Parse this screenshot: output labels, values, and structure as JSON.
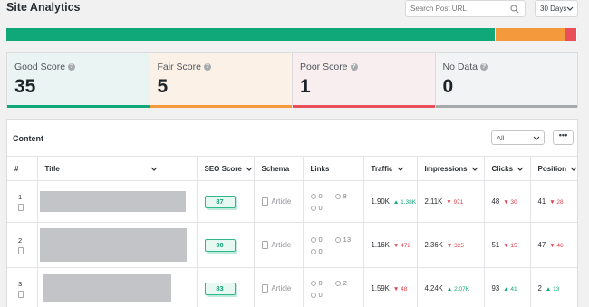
{
  "header": {
    "title": "Site Analytics",
    "search_placeholder": "Search Post URL",
    "range": "30 Days"
  },
  "score_bar": {
    "segments": [
      {
        "name": "good",
        "fraction": 0.8571,
        "color": "#10a779"
      },
      {
        "name": "fair",
        "fraction": 0.1224,
        "color": "#f59a3c"
      },
      {
        "name": "poor",
        "fraction": 0.0204,
        "color": "#e94f5b"
      }
    ]
  },
  "cards": [
    {
      "label": "Good Score",
      "value": "35",
      "bg": "#eaf4f2",
      "accent": "#10a779"
    },
    {
      "label": "Fair Score",
      "value": "5",
      "bg": "#fcf1e7",
      "accent": "#f59a3c"
    },
    {
      "label": "Poor Score",
      "value": "1",
      "bg": "#f8eef0",
      "accent": "#e94f5b"
    },
    {
      "label": "No Data",
      "value": "0",
      "bg": "#f2f3f5",
      "accent": "#a7aaad"
    }
  ],
  "content": {
    "title": "Content",
    "filter": "All",
    "more": "•••",
    "columns": [
      "#",
      "Title",
      "SEO Score",
      "Schema",
      "Links",
      "Traffic",
      "Impressions",
      "Clicks",
      "Position"
    ],
    "rows": [
      {
        "index": "1",
        "seo": "87",
        "schema": "Article",
        "internal": "0",
        "external": "8",
        "incoming": "0",
        "traffic": "1.90K",
        "traffic_delta": "▲ 1.38K",
        "traffic_dir": "up",
        "impr": "2.11K",
        "impr_delta": "▼ 971",
        "impr_dir": "down",
        "clicks": "48",
        "clicks_delta": "▼ 30",
        "clicks_dir": "down",
        "pos": "41",
        "pos_delta": "▼ 28",
        "pos_dir": "down"
      },
      {
        "index": "2",
        "seo": "90",
        "schema": "Article",
        "internal": "0",
        "external": "13",
        "incoming": "0",
        "traffic": "1.16K",
        "traffic_delta": "▼ 472",
        "traffic_dir": "down",
        "impr": "2.36K",
        "impr_delta": "▼ 325",
        "impr_dir": "down",
        "clicks": "51",
        "clicks_delta": "▼ 15",
        "clicks_dir": "down",
        "pos": "47",
        "pos_delta": "▼ 46",
        "pos_dir": "down"
      },
      {
        "index": "3",
        "seo": "83",
        "schema": "Article",
        "internal": "0",
        "external": "2",
        "incoming": "0",
        "traffic": "1.59K",
        "traffic_delta": "▼ 48",
        "traffic_dir": "down",
        "impr": "4.24K",
        "impr_delta": "▲ 2.07K",
        "impr_dir": "up",
        "clicks": "93",
        "clicks_delta": "▲ 41",
        "clicks_dir": "up",
        "pos": "2",
        "pos_delta": "▲ 13",
        "pos_dir": "up"
      }
    ]
  }
}
